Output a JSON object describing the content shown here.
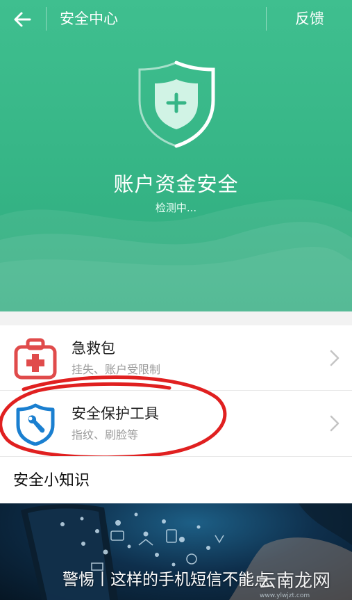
{
  "header": {
    "title": "安全中心",
    "feedback_label": "反馈"
  },
  "hero": {
    "title": "账户资金安全",
    "status": "检测中..."
  },
  "items": [
    {
      "title": "急救包",
      "subtitle": "挂失、账户受限制",
      "icon": "first-aid-kit-icon"
    },
    {
      "title": "安全保护工具",
      "subtitle": "指纹、刷脸等",
      "icon": "shield-wrench-icon"
    }
  ],
  "knowledge": {
    "title": "安全小知识"
  },
  "banner": {
    "caption": "警惕丨这样的手机短信不能点",
    "watermark": "云南龙网",
    "watermark_url": "www.ylwjzt.com"
  },
  "colors": {
    "primary": "#36b586",
    "first_aid": "#e04b4b",
    "shield_blue": "#1a7fd0",
    "highlight": "#e02020"
  }
}
